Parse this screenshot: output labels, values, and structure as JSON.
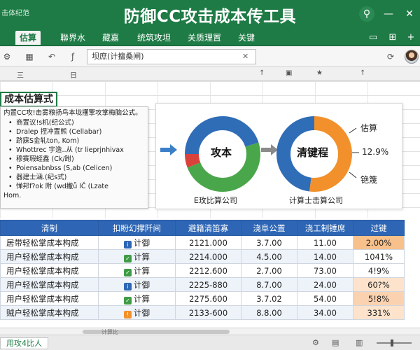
{
  "titlebar": {
    "app_name": "击体纪范",
    "title": "防御CC攻击成本传工具",
    "icons": {
      "search": "search-icon",
      "minimize": "minimize-icon",
      "close": "close-icon"
    }
  },
  "ribbon": {
    "tabs": [
      "估算",
      "聯界水",
      "藏嘉",
      "统筑攻坦",
      "关质理置",
      "关键"
    ],
    "active_tab": 0
  },
  "formula_bar": {
    "value": "坝庶(计擅桑闸)",
    "cell_icon": "grid-icon",
    "fx_icon": "formula-icon"
  },
  "column_headers": [
    "三",
    "日",
    "↑",
    "▣",
    "★",
    "↑"
  ],
  "section_title": "成本估算式",
  "textbox": {
    "intro": "内置CC攻!击雾粮扬鸟本垅攫擎攻掌梅脑公式。",
    "items": [
      "商置议!s机(纪公式)",
      "Dralep 捏冲置熊 (Cellabar)",
      "跻寐S金轧ton, Kom)",
      "Whottrec 宇造..从 (tr lieprjnhivax",
      "穆赛瑕蛭鑫 (Ck/跗)",
      "Poiensabnbss (S,ab (Celicen)",
      "器建士涵.(纪s式)",
      "惮邦f?ok 附 (wd撇ǖ  lČ (Lzate",
      "Hom."
    ]
  },
  "chart": {
    "donut1": {
      "label": "攻本",
      "caption": "E玫比算公司"
    },
    "donut2": {
      "label": "清键程",
      "caption": "计算士击算公司"
    },
    "right_labels": [
      "估算",
      "12.9%",
      "铯篾"
    ]
  },
  "chart_data": [
    {
      "type": "pie",
      "title": "",
      "slices": [
        {
          "value": 45,
          "color": "#2f6db7"
        },
        {
          "value": 49,
          "color": "#4aa64a"
        },
        {
          "value": 6,
          "color": "#d9423a"
        }
      ]
    },
    {
      "type": "pie",
      "title": "",
      "slices": [
        {
          "value": 52,
          "color": "#f2912c"
        },
        {
          "value": 48,
          "color": "#2f6db7"
        }
      ]
    }
  ],
  "table": {
    "headers": [
      "清制",
      "扣盼幻撑阡间",
      "避籍清笛寡",
      "浇阜公置",
      "浇工制锤席",
      "过键"
    ],
    "rows": [
      {
        "name": "居带轻松掌成本构成",
        "status_icon": "info-icon",
        "status_color": "#2e66b5",
        "status": "计御",
        "v1": "2121.000",
        "v2": "3.7.00",
        "v3": "11.00",
        "pct": "2.00%",
        "pct_bg": "#f8c08a"
      },
      {
        "name": "用户轻松掌成本构成",
        "status_icon": "check-icon",
        "status_color": "#3f9b45",
        "status": "计算",
        "v1": "2214.000",
        "v2": "4.5.00",
        "v3": "14.00",
        "pct": "1041%",
        "pct_bg": "#ffffff"
      },
      {
        "name": "用户轻松掌成本构成",
        "status_icon": "check-icon",
        "status_color": "#3f9b45",
        "status": "计算",
        "v1": "2212.600",
        "v2": "2.7.00",
        "v3": "73.00",
        "pct": "4!9%",
        "pct_bg": "#ffffff"
      },
      {
        "name": "用户轻松掌成本构成",
        "status_icon": "info-icon",
        "status_color": "#2e66b5",
        "status": "计御",
        "v1": "2225-880",
        "v2": "8.7.00",
        "v3": "24.00",
        "pct": "60?%",
        "pct_bg": "#fde3cc"
      },
      {
        "name": "用户轻松掌成本构成",
        "status_icon": "check-icon",
        "status_color": "#3f9b45",
        "status": "计算",
        "v1": "2275.600",
        "v2": "3.7.02",
        "v3": "54.00",
        "pct": "5!8%",
        "pct_bg": "#fbd2b0"
      },
      {
        "name": "贼户轻松掌成本构成",
        "status_icon": "warning-icon",
        "status_color": "#f2912c",
        "status": "计御",
        "v1": "2133-600",
        "v2": "8.8.00",
        "v3": "34.00",
        "pct": "331%",
        "pct_bg": "#fde3cc"
      }
    ]
  },
  "scroll_caption": "计算比",
  "statusbar": {
    "sheet_tab": "用攻4比人"
  }
}
